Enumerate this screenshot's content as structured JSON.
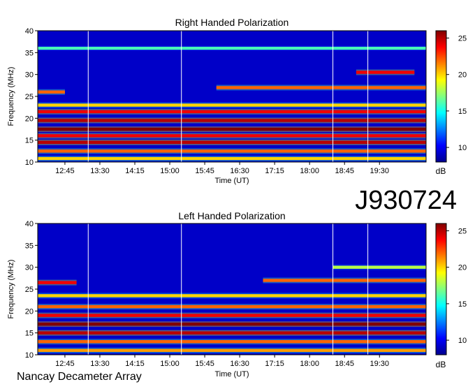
{
  "figure": {
    "id_label": "J930724",
    "instrument": "Nancay Decameter Array"
  },
  "colors": {
    "colormap": [
      "#00008f",
      "#0000ff",
      "#0080ff",
      "#00ffff",
      "#80ff80",
      "#ffff00",
      "#ff8000",
      "#ff0000",
      "#800000"
    ],
    "gridlines": "#ffffff"
  },
  "chart_data": [
    {
      "type": "heatmap",
      "title": "Right Handed Polarization",
      "xlabel": "Time (UT)",
      "ylabel": "Frequency (MHz)",
      "x_ticks": [
        "12:45",
        "13:30",
        "14:15",
        "15:00",
        "15:45",
        "16:30",
        "17:15",
        "18:00",
        "18:45",
        "19:30"
      ],
      "y_ticks": [
        10,
        15,
        20,
        25,
        30,
        35,
        40
      ],
      "ylim": [
        10,
        40
      ],
      "colorbar": {
        "label": "dB",
        "ticks": [
          10,
          15,
          20,
          25
        ],
        "range": [
          8,
          26
        ]
      },
      "vertical_markers": [
        "13:15",
        "15:15",
        "18:30",
        "19:15"
      ],
      "bands": [
        {
          "f": 10.8,
          "db": 20,
          "t0": "12:00",
          "t1": "20:30"
        },
        {
          "f": 12.5,
          "db": 22,
          "t0": "12:00",
          "t1": "20:30"
        },
        {
          "f": 14.5,
          "db": 25,
          "t0": "12:00",
          "t1": "20:30"
        },
        {
          "f": 16.0,
          "db": 24,
          "t0": "12:00",
          "t1": "20:30"
        },
        {
          "f": 17.5,
          "db": 26,
          "t0": "12:00",
          "t1": "20:30"
        },
        {
          "f": 19.5,
          "db": 25,
          "t0": "12:00",
          "t1": "20:30"
        },
        {
          "f": 21.5,
          "db": 24,
          "t0": "12:00",
          "t1": "20:30"
        },
        {
          "f": 23.0,
          "db": 20,
          "t0": "12:00",
          "t1": "20:30"
        },
        {
          "f": 26.0,
          "db": 22,
          "t0": "12:00",
          "t1": "12:45"
        },
        {
          "f": 27.0,
          "db": 22,
          "t0": "16:00",
          "t1": "20:30"
        },
        {
          "f": 30.5,
          "db": 24,
          "t0": "19:00",
          "t1": "20:15"
        },
        {
          "f": 36.0,
          "db": 16,
          "t0": "12:00",
          "t1": "20:30"
        }
      ]
    },
    {
      "type": "heatmap",
      "title": "Left Handed Polarization",
      "xlabel": "Time (UT)",
      "ylabel": "Frequency (MHz)",
      "x_ticks": [
        "12:45",
        "13:30",
        "14:15",
        "15:00",
        "15:45",
        "16:30",
        "17:15",
        "18:00",
        "18:45",
        "19:30"
      ],
      "y_ticks": [
        10,
        15,
        20,
        25,
        30,
        35,
        40
      ],
      "ylim": [
        10,
        40
      ],
      "colorbar": {
        "label": "dB",
        "ticks": [
          10,
          15,
          20,
          25
        ],
        "range": [
          8,
          26
        ]
      },
      "vertical_markers": [
        "13:15",
        "15:15",
        "18:30",
        "19:15"
      ],
      "bands": [
        {
          "f": 11.0,
          "db": 21,
          "t0": "12:00",
          "t1": "20:30"
        },
        {
          "f": 13.0,
          "db": 22,
          "t0": "12:00",
          "t1": "20:30"
        },
        {
          "f": 15.0,
          "db": 25,
          "t0": "12:00",
          "t1": "20:30"
        },
        {
          "f": 17.0,
          "db": 26,
          "t0": "12:00",
          "t1": "20:30"
        },
        {
          "f": 19.0,
          "db": 24,
          "t0": "12:00",
          "t1": "20:30"
        },
        {
          "f": 21.0,
          "db": 22,
          "t0": "12:00",
          "t1": "20:30"
        },
        {
          "f": 23.5,
          "db": 20,
          "t0": "12:00",
          "t1": "20:30"
        },
        {
          "f": 26.5,
          "db": 24,
          "t0": "12:00",
          "t1": "13:00"
        },
        {
          "f": 27.0,
          "db": 22,
          "t0": "17:00",
          "t1": "20:30"
        },
        {
          "f": 30.0,
          "db": 18,
          "t0": "18:30",
          "t1": "20:30"
        }
      ]
    }
  ]
}
